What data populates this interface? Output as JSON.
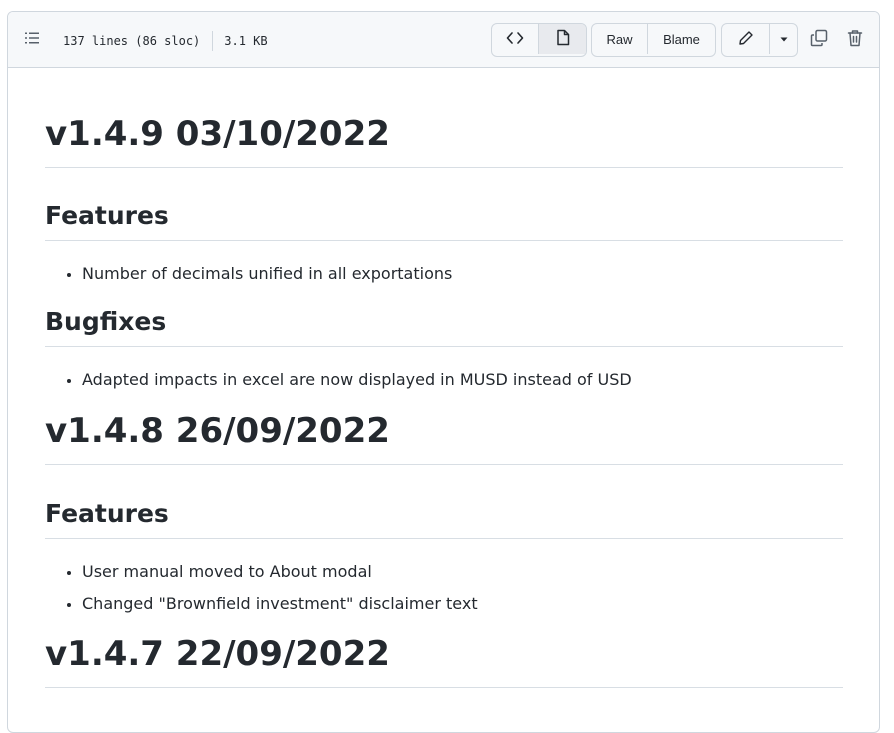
{
  "header": {
    "lines_info": "137 lines (86 sloc)",
    "size_info": "3.1 KB",
    "raw_label": "Raw",
    "blame_label": "Blame"
  },
  "icons": {
    "outline": "list-unordered-icon",
    "code": "code-icon",
    "preview": "file-icon",
    "edit": "pencil-icon",
    "more": "triangle-down-icon",
    "copy": "copy-icon",
    "delete": "trash-icon"
  },
  "doc": {
    "v149": {
      "title": "v1.4.9 03/10/2022",
      "features_heading": "Features",
      "features": [
        "Number of decimals unified in all exportations"
      ],
      "bugfixes_heading": "Bugfixes",
      "bugfixes": [
        "Adapted impacts in excel are now displayed in MUSD instead of USD"
      ]
    },
    "v148": {
      "title": "v1.4.8 26/09/2022",
      "features_heading": "Features",
      "features": [
        "User manual moved to About modal",
        "Changed \"Brownfield investment\" disclaimer text"
      ]
    },
    "v147": {
      "title": "v1.4.7 22/09/2022"
    }
  },
  "colors": {
    "text": "#24292f",
    "muted": "#57606a",
    "border": "#d0d7de",
    "header_bg": "#f6f8fa"
  }
}
